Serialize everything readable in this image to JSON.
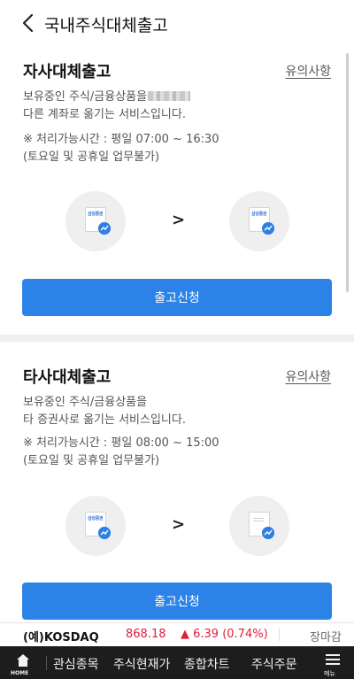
{
  "header": {
    "title": "국내주식대체출고",
    "back_icon": "chevron-left-icon"
  },
  "sections": [
    {
      "title": "자사대체출고",
      "notice_link": "유의사항",
      "desc_line1": "보유중인 주식/금융상품을",
      "desc_line2": "다른 계좌로 옮기는 서비스입니다.",
      "hours_line1": "※ 처리가능시간 : 평일 07:00 ~ 16:30",
      "hours_line2": "(토요일 및 공휴일 업무불가)",
      "from_logo": "삼성증권",
      "to_logo": "삼성증권",
      "arrow": ">",
      "button": "출고신청"
    },
    {
      "title": "타사대체출고",
      "notice_link": "유의사항",
      "desc_line1": "보유중인 주식/금융상품을",
      "desc_line2": "타 증권사로 옮기는 서비스입니다.",
      "hours_line1": "※ 처리가능시간 : 평일 08:00 ~ 15:00",
      "hours_line2": "(토요일 및 공휴일 업무불가)",
      "from_logo": "삼성증권",
      "arrow": ">",
      "button": "출고신청"
    }
  ],
  "ticker": {
    "name": "(예)KOSDAQ",
    "price": "868.18",
    "change": "▲ 6.39 (0.74%)",
    "status": "장마감",
    "up_color": "#e01e3c"
  },
  "bottom_nav": {
    "home_label": "HOME",
    "items": [
      "관심종목",
      "주식현재가",
      "종합차트",
      "주식주문"
    ],
    "menu_label": "메뉴"
  },
  "colors": {
    "accent": "#2b83e8",
    "nav_bg": "#1d1d1d"
  }
}
